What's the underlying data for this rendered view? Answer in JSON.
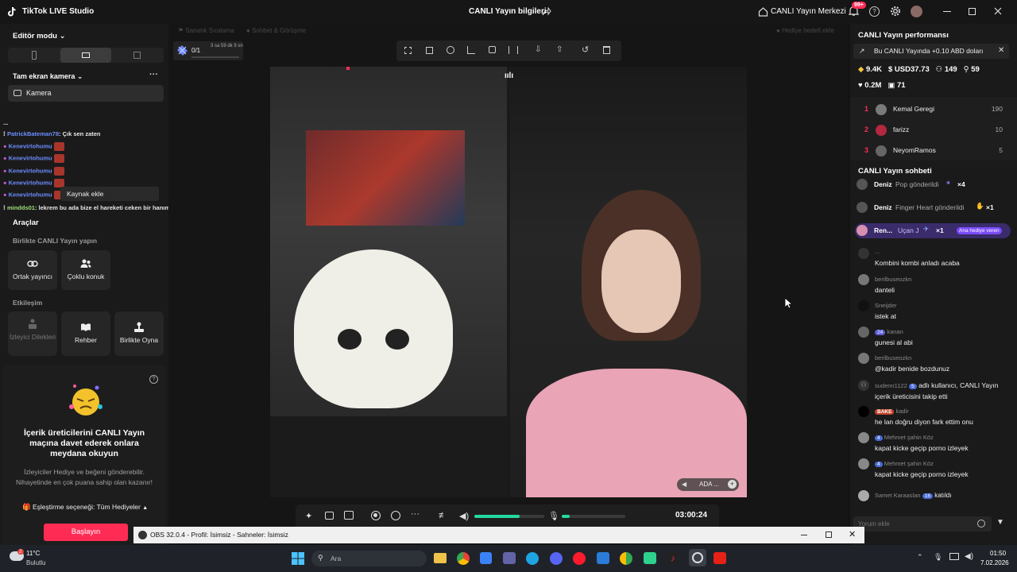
{
  "titlebar": {
    "app_title": "TikTok LIVE Studio",
    "stream_info": "CANLI Yayın bilgileri",
    "live_center": "CANLI Yayın Merkezi",
    "notif_badge": "99+"
  },
  "left": {
    "editor_mode": "Editör modu",
    "source_title": "Tam ekran kamera",
    "camera_label": "Kamera",
    "add_source": "Kaynak ekle",
    "chat": [
      {
        "user": "PatrickBateman78",
        "text": ": Çık sen zaten"
      },
      {
        "user": "Kenevirtohumu",
        "text": ""
      },
      {
        "user": "Kenevirtohumu",
        "text": ""
      },
      {
        "user": "Kenevirtohumu",
        "text": ""
      },
      {
        "user": "Kenevirtohumu",
        "text": ""
      },
      {
        "user": "Kenevirtohumu",
        "text": ""
      },
      {
        "user": "mindds01",
        "text": ": lekrem bu ada bize el hareketi ceken bir hanım efendi"
      }
    ],
    "tools_title": "Araçlar",
    "together_title": "Birlikte CANLI Yayın yapın",
    "tool_cohost": "Ortak yayıncı",
    "tool_multi": "Çoklu konuk",
    "interaction_title": "Etkileşim",
    "tool_wishes": "İzleyici Dilekleri",
    "tool_guide": "Rehber",
    "tool_play": "Birlikte Oyna",
    "promo_title": "İçerik üreticilerini CANLI Yayın maçına davet ederek onlara meydana okuyun",
    "promo_text": "İzleyiciler Hediye ve beğeni gönderebilir. Nihayetinde en çok puana sahip olan kazanır!",
    "match_option": "Eşleştirme seçeneği: Tüm Hediyeler",
    "start_button": "Başlayın"
  },
  "center": {
    "tab_left": "Sanatık Sıralama",
    "tab_mid": "Sohbet & Görüşme",
    "gift_goal": "Hediye hedefi ekle",
    "goal_count": "0/1",
    "goal_time": "3 sa 59 dk 9 sn",
    "guest_name": "ADA ...",
    "timer": "03:00:24"
  },
  "right": {
    "perf_title": "CANLI Yayın performansı",
    "earn_banner": "Bu CANLI Yayında +0.10 ABD doları",
    "stats": {
      "diamonds": "9.4K",
      "usd": "USD37.73",
      "viewers": "149",
      "followers": "59",
      "likes": "0.2M",
      "gifters": "71"
    },
    "ranking": [
      {
        "rank": "1",
        "name": "Kemal Geregi",
        "score": "190"
      },
      {
        "rank": "2",
        "name": "farizz",
        "score": "10"
      },
      {
        "rank": "3",
        "name": "NeyomRamos",
        "score": "5"
      }
    ],
    "chat_title": "CANLI Yayın sohbeti",
    "gifts": [
      {
        "user": "Deniz",
        "text": "Pop gönderildi",
        "count": "×4"
      },
      {
        "user": "Deniz",
        "text": "Finger Heart gönderildi",
        "count": "×1"
      },
      {
        "user": "Ren...",
        "text": "Uçan J",
        "count": "×1",
        "badge": "Ana hediye veren"
      }
    ],
    "messages": [
      {
        "user": "...",
        "level": "",
        "text": "Kombini kombi anladı acaba"
      },
      {
        "user": "berilbuseozkn",
        "level": "",
        "text": "danteli"
      },
      {
        "user": "Sneijder",
        "level": "",
        "text": "istek at"
      },
      {
        "user": "kanan",
        "level": "24",
        "text": "gunesi al abi"
      },
      {
        "user": "berilbuseozkn",
        "level": "",
        "text": "@kadir benide bozdunuz"
      },
      {
        "user": "sudenn1122",
        "level": "5",
        "text": "adlı kullanıcı, CANLI Yayın içerik üreticisini takip etti"
      },
      {
        "user": "kadir",
        "level": "BAKE",
        "text": "he lan doğru diyon fark ettim onu"
      },
      {
        "user": "Mehmet şahin Köz",
        "level": "4",
        "text": "kapat kicke geçip porno izleyek"
      },
      {
        "user": "Mehmet şahin Köz",
        "level": "4",
        "text": "kapat kicke geçip porno izleyek"
      },
      {
        "user": "Samet Karaaslan",
        "level": "16",
        "text": "katıldı"
      }
    ],
    "comment_placeholder": "Yorum ekle"
  },
  "obs": {
    "title": "OBS 32.0.4 - Profil: İsimsiz - Sahneler: İsimsiz"
  },
  "taskbar": {
    "temp": "11°C",
    "weather": "Bulutlu",
    "search": "Ara",
    "time": "01:50",
    "date": "7.02.2026",
    "weather_badge": "2"
  },
  "colors": {
    "accent": "#fe2c55",
    "progress": "#25d9a0",
    "purple": "#7b4cff"
  }
}
